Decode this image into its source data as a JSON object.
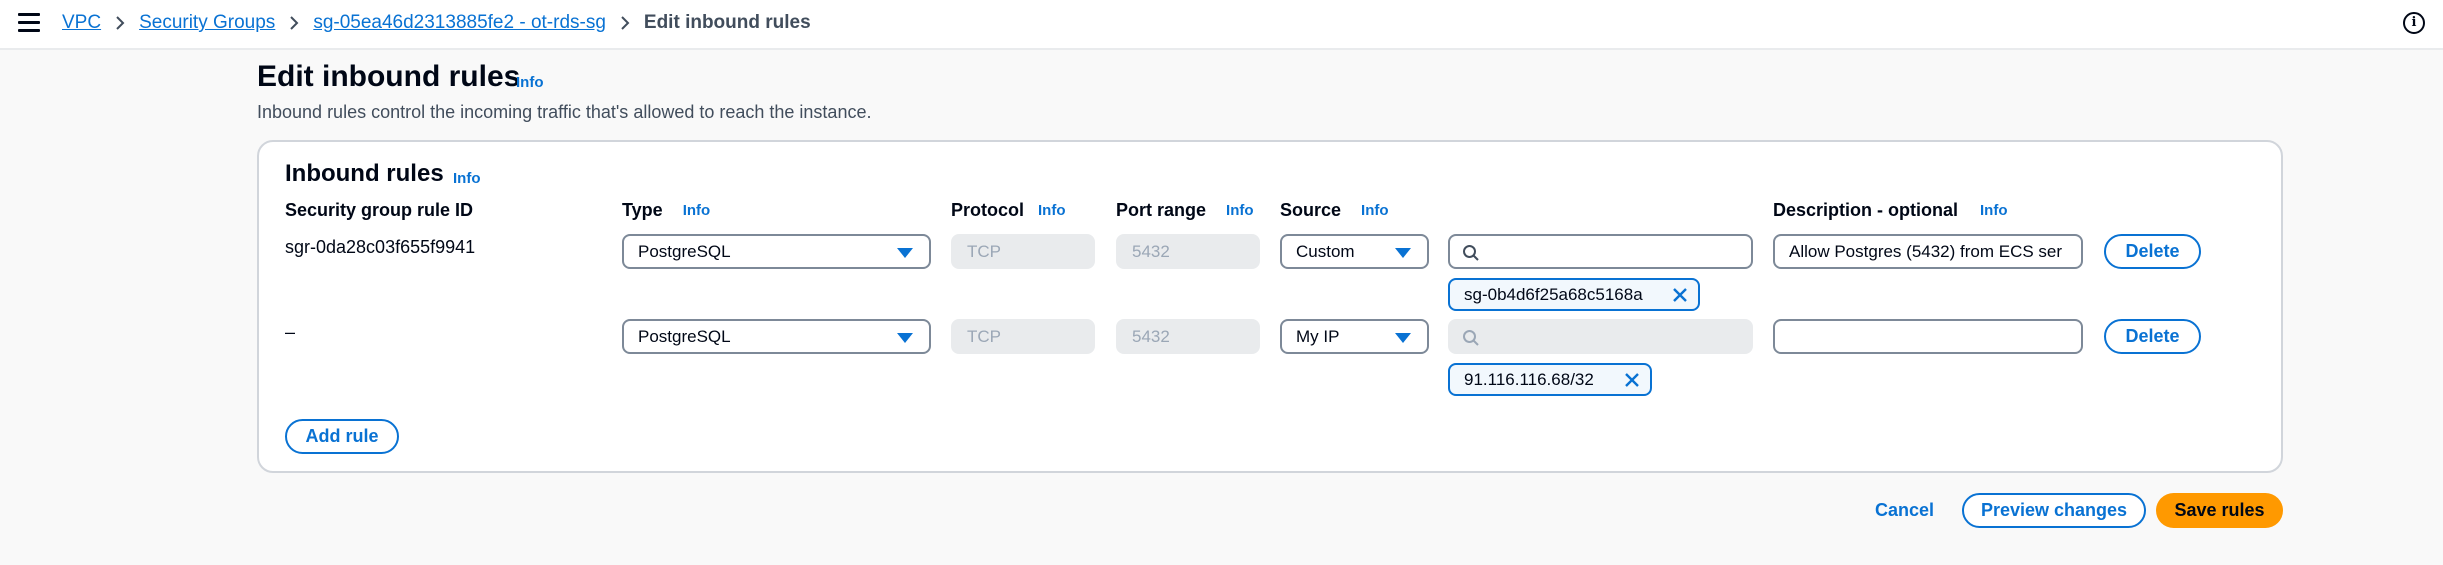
{
  "breadcrumbs": {
    "vpc": "VPC",
    "security_groups": "Security Groups",
    "sg": "sg-05ea46d2313885fe2 - ot-rds-sg",
    "current": "Edit inbound rules"
  },
  "page": {
    "title": "Edit inbound rules",
    "info": "Info",
    "description": "Inbound rules control the incoming traffic that's allowed to reach the instance."
  },
  "section": {
    "title": "Inbound rules",
    "info": "Info"
  },
  "columns": {
    "rule_id": "Security group rule ID",
    "type": "Type",
    "type_info": "Info",
    "protocol": "Protocol",
    "protocol_info": "Info",
    "port_range": "Port range",
    "port_range_info": "Info",
    "source": "Source",
    "source_info": "Info",
    "description": "Description - optional",
    "description_info": "Info"
  },
  "rules": [
    {
      "rule_id": "sgr-0da28c03f655f9941",
      "type": "PostgreSQL",
      "protocol": "TCP",
      "port_range": "5432",
      "source": "Custom",
      "search_value": "",
      "token": "sg-0b4d6f25a68c5168a",
      "description": "Allow Postgres (5432) from ECS ser",
      "delete_label": "Delete"
    },
    {
      "rule_id": "–",
      "type": "PostgreSQL",
      "protocol": "TCP",
      "port_range": "5432",
      "source": "My IP",
      "search_value": "",
      "token": "91.116.116.68/32",
      "description": "",
      "delete_label": "Delete"
    }
  ],
  "add_rule_label": "Add rule",
  "footer": {
    "cancel": "Cancel",
    "preview": "Preview changes",
    "save": "Save rules"
  },
  "colors": {
    "link": "#0972d3",
    "primary": "#ff9900",
    "border": "#7d8998",
    "disabled_bg": "#e9ebed"
  }
}
